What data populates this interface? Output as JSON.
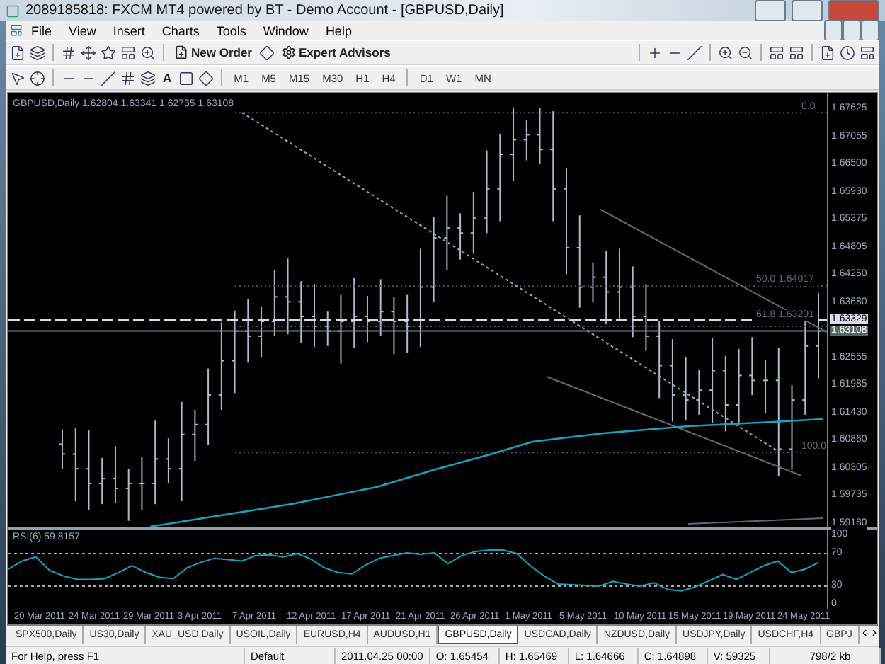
{
  "window": {
    "title": "2089185818: FXCM MT4 powered by BT - Demo Account - [GBPUSD,Daily]"
  },
  "menu": [
    "File",
    "View",
    "Insert",
    "Charts",
    "Tools",
    "Window",
    "Help"
  ],
  "toolbar": {
    "buttons": [
      {
        "label": "New Order"
      },
      {
        "label": "Expert Advisors"
      }
    ]
  },
  "drawing_tools": {
    "text_tool": "A"
  },
  "timeframes": [
    {
      "label": "M1"
    },
    {
      "label": "M5"
    },
    {
      "label": "M15"
    },
    {
      "label": "M30"
    },
    {
      "label": "H1"
    },
    {
      "label": "H4"
    },
    {
      "label": "D1"
    },
    {
      "label": "W1"
    },
    {
      "label": "MN"
    }
  ],
  "chart": {
    "header": "GBPUSD,Daily  1.62804 1.63341 1.62735 1.63108",
    "fib_levels": [
      {
        "label": "0.0"
      },
      {
        "label": "50.0",
        "price": "1.64017"
      },
      {
        "label": "61.8",
        "price": "1.63201"
      },
      {
        "label": "100.0"
      }
    ],
    "price_axis": [
      "1.67625",
      "1.67055",
      "1.66500",
      "1.65930",
      "1.65375",
      "1.64805",
      "1.64250",
      "1.63680",
      "1.62555",
      "1.61985",
      "1.61430",
      "1.60860",
      "1.60305",
      "1.59735",
      "1.59180"
    ],
    "price_markers": [
      {
        "kind": "ask",
        "value": "1.63329"
      },
      {
        "kind": "bid",
        "value": "1.63108"
      }
    ],
    "indicator": {
      "label": "RSI(6) 59.8157",
      "axis": [
        "100",
        "70",
        "30",
        "0"
      ]
    },
    "dates": [
      "20 Mar 2011",
      "24 Mar 2011",
      "29 Mar 2011",
      "3 Apr 2011",
      "7 Apr 2011",
      "12 Apr 2011",
      "17 Apr 2011",
      "21 Apr 2011",
      "26 Apr 2011",
      "1 May 2011",
      "5 May 2011",
      "10 May 2011",
      "15 May 2011",
      "19 May 2011",
      "24 May 2011"
    ]
  },
  "chart_tabs": [
    {
      "label": "SPX500,Daily",
      "selected": false
    },
    {
      "label": "US30,Daily",
      "selected": false
    },
    {
      "label": "XAU_USD,Daily",
      "selected": false
    },
    {
      "label": "USOIL,Daily",
      "selected": false
    },
    {
      "label": "EURUSD,H4",
      "selected": false
    },
    {
      "label": "AUDUSD,H1",
      "selected": false
    },
    {
      "label": "GBPUSD,Daily",
      "selected": true
    },
    {
      "label": "USDCAD,Daily",
      "selected": false
    },
    {
      "label": "NZDUSD,Daily",
      "selected": false
    },
    {
      "label": "USDJPY,Daily",
      "selected": false
    },
    {
      "label": "USDCHF,H4",
      "selected": false
    },
    {
      "label": "GBPJ",
      "selected": false
    }
  ],
  "status_bar": [
    "For Help, press F1",
    "Default",
    "2011.04.25 00:00",
    "O: 1.65454",
    "H: 1.65469",
    "L: 1.64666",
    "C: 1.64898",
    "V: 59325",
    "798/2 kb"
  ]
}
